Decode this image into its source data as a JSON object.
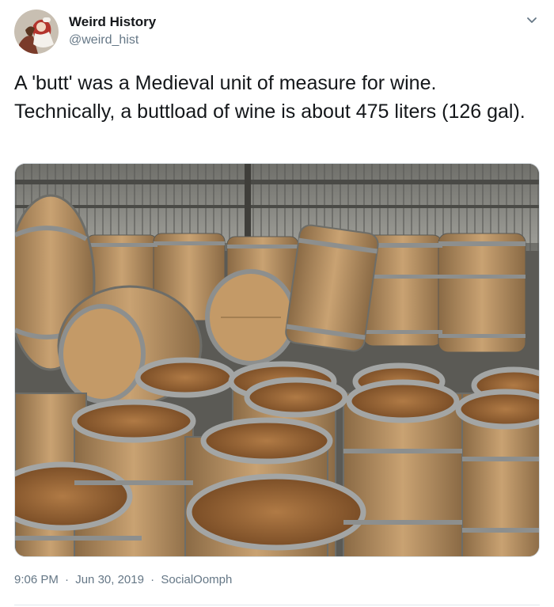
{
  "tweet": {
    "author": {
      "name": "Weird History",
      "handle": "@weird_hist"
    },
    "text": "A 'butt' was a Medieval unit of measure for wine. Technically, a buttload of wine is about 475 liters (126 gal).",
    "timestamp": {
      "time": "9:06 PM",
      "separator": "·",
      "date": "Jun 30, 2019",
      "source": "SocialOomph"
    },
    "icons": {
      "menu": "chevron-down-icon"
    }
  },
  "colors": {
    "primary_text": "#14171a",
    "secondary_text": "#657786",
    "divider": "#e1e8ed"
  }
}
